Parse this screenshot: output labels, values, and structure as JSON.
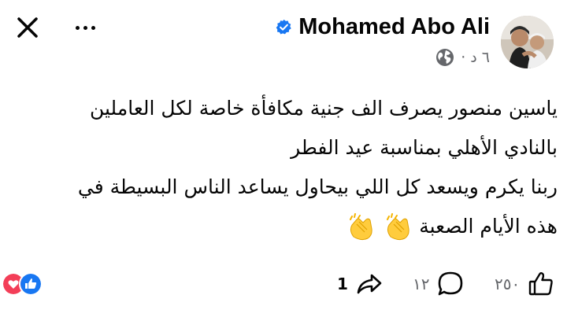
{
  "header": {
    "author_name": "Mohamed Abo Ali",
    "timestamp": "٦ د ·"
  },
  "post": {
    "lines": [
      "ياسين منصور يصرف الف جنية مكافأة خاصة لكل العاملين",
      "بالنادي الأهلي بمناسبة عيد الفطر",
      "ربنا يكرم ويسعد كل اللي بيحاول يساعد الناس البسيطة في",
      "هذه الأيام الصعبة"
    ]
  },
  "footer": {
    "share_count": "1",
    "comment_count": "١٢",
    "like_count": "٢٥٠"
  },
  "colors": {
    "verified_blue": "#1877f2",
    "meta_gray": "#65676b",
    "text": "#050505",
    "love_red": "#f33e58",
    "like_blue": "#1877f2"
  }
}
